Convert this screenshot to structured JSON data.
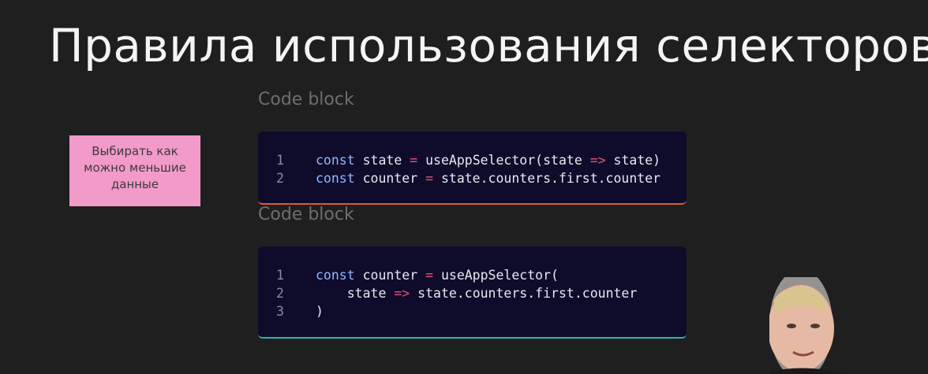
{
  "slide": {
    "title": "Правила использования селекторов",
    "sticky_note": "Выбирать как можно меньшие данные"
  },
  "code_blocks": [
    {
      "label": "Code block",
      "accent_color": "#e25a2a",
      "lines": [
        {
          "num": "1",
          "tokens": [
            {
              "t": "const",
              "c": "kw"
            },
            {
              "t": " state ",
              "c": "id"
            },
            {
              "t": "=",
              "c": "op"
            },
            {
              "t": " useAppSelector(state ",
              "c": "id"
            },
            {
              "t": "=>",
              "c": "op"
            },
            {
              "t": " state)",
              "c": "id"
            }
          ]
        },
        {
          "num": "2",
          "tokens": [
            {
              "t": "const",
              "c": "kw"
            },
            {
              "t": " counter ",
              "c": "id"
            },
            {
              "t": "=",
              "c": "op"
            },
            {
              "t": " state.counters.first.counter",
              "c": "id"
            }
          ]
        }
      ]
    },
    {
      "label": "Code block",
      "accent_color": "#2fb6a5",
      "lines": [
        {
          "num": "1",
          "tokens": [
            {
              "t": "const",
              "c": "kw"
            },
            {
              "t": " counter ",
              "c": "id"
            },
            {
              "t": "=",
              "c": "op"
            },
            {
              "t": " useAppSelector(",
              "c": "id"
            }
          ]
        },
        {
          "num": "2",
          "tokens": [
            {
              "t": "    state ",
              "c": "id"
            },
            {
              "t": "=>",
              "c": "op"
            },
            {
              "t": " state.counters.first.counter",
              "c": "id"
            }
          ]
        },
        {
          "num": "3",
          "tokens": [
            {
              "t": ")",
              "c": "id"
            }
          ]
        }
      ]
    }
  ],
  "colors": {
    "background": "#1f1f20",
    "code_background": "#0f0c2b",
    "keyword": "#8fb8ff",
    "operator": "#e8527a",
    "sticky_note": "#f29ac9"
  }
}
